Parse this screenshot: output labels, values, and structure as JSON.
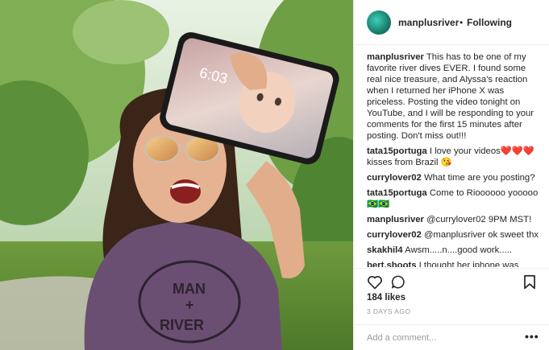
{
  "post": {
    "username": "manplusriver",
    "separator": "•",
    "follow_status": "Following"
  },
  "comments": [
    {
      "user": "manplusriver",
      "text": "This has to be one of my favorite river dives EVER. I found some real nice treasure, and Alyssa's reaction when I returned her iPhone X was priceless. Posting the video tonight on YouTube, and I will be responding to your comments for the first 15 minutes after posting. Don't miss out!!!"
    },
    {
      "user": "tata15portuga",
      "text": "I love your videos❤️❤️❤️ kisses from Brazil 😘"
    },
    {
      "user": "currylover02",
      "text": "What time are you posting?"
    },
    {
      "user": "tata15portuga",
      "text": "Come to Rioooooo yooooo 🇧🇷🇧🇷"
    },
    {
      "user": "manplusriver",
      "text": "@currylover02 9PM MST!"
    },
    {
      "user": "currylover02",
      "text": "@manplusriver ok sweet thx"
    },
    {
      "user": "skakhil4",
      "text": "Awsm.....n....good work....."
    },
    {
      "user": "bert.shoots",
      "text": "I thought her iphone was broken when you found it at the river. There"
    }
  ],
  "stats": {
    "likes": "184 likes",
    "posted": "3 DAYS AGO"
  },
  "add_comment": {
    "placeholder": "Add a comment...",
    "more": "•••"
  },
  "photo": {
    "lock_time": "6:03",
    "shirt_text_top": "MAN",
    "shirt_text_plus": "+",
    "shirt_text_bottom": "RIVER"
  },
  "colors": {
    "text": "#262626",
    "meta": "#999999",
    "divider": "#efefef",
    "shirt": "#6b4f72"
  },
  "icons": [
    "heart-icon",
    "comment-icon",
    "bookmark-icon"
  ]
}
